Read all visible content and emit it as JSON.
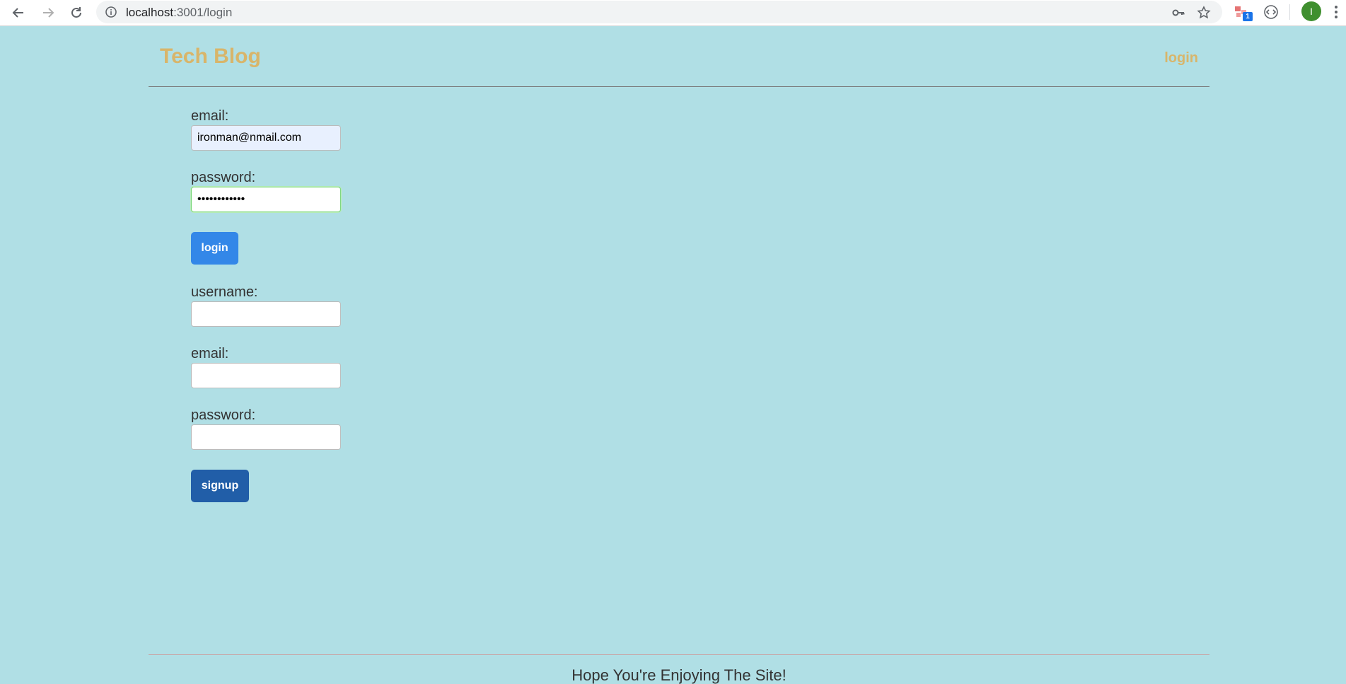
{
  "browser": {
    "url_host": "localhost",
    "url_path": ":3001/login",
    "avatar_letter": "I",
    "extension_badge": "1",
    "icons": [
      "back-arrow-icon",
      "forward-arrow-icon",
      "reload-icon",
      "info-icon",
      "key-icon",
      "star-icon",
      "extension-icon",
      "code-icon",
      "menu-dots-icon"
    ]
  },
  "header": {
    "brand": "Tech Blog",
    "login_link": "login"
  },
  "login_form": {
    "email_label": "email:",
    "email_value": "ironman@nmail.com",
    "password_label": "password:",
    "password_value": "••••••••••••",
    "submit_label": "login"
  },
  "signup_form": {
    "username_label": "username:",
    "username_value": "",
    "email_label": "email:",
    "email_value": "",
    "password_label": "password:",
    "password_value": "",
    "submit_label": "signup"
  },
  "footer": {
    "text": "Hope You're Enjoying The Site!"
  },
  "colors": {
    "page_background": "#b0dfe5",
    "brand": "#d8b56a",
    "login_button": "#3387e8",
    "signup_button": "#215ea8"
  }
}
